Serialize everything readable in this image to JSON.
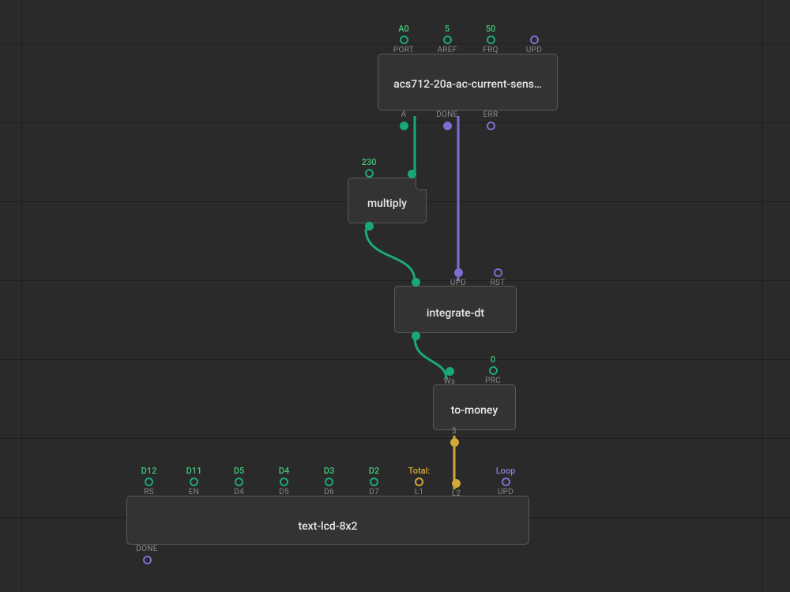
{
  "colors": {
    "teal": "#1ba877",
    "purple": "#7b6fd1",
    "yellow": "#d2a83a",
    "bg": "#2a2a2a",
    "node": "#333333"
  },
  "nodes": {
    "sensor": {
      "title": "acs712-20a-ac-current-sens…",
      "inputs": [
        {
          "name": "PORT",
          "value": "A0",
          "color": "teal"
        },
        {
          "name": "AREF",
          "value": "5",
          "color": "teal"
        },
        {
          "name": "FRQ",
          "value": "50",
          "color": "teal"
        },
        {
          "name": "UPD",
          "value": "",
          "color": "purple"
        }
      ],
      "outputs": [
        {
          "name": "A",
          "color": "teal",
          "filled": true
        },
        {
          "name": "DONE",
          "color": "purple",
          "filled": true
        },
        {
          "name": "ERR",
          "color": "purple",
          "filled": false
        }
      ]
    },
    "multiply": {
      "title": "multiply",
      "inputs": [
        {
          "name": "",
          "value": "230",
          "color": "teal"
        },
        {
          "name": "",
          "value": "",
          "color": "teal",
          "filled": true
        }
      ],
      "outputs": [
        {
          "name": "",
          "color": "teal",
          "filled": true
        }
      ]
    },
    "integrate": {
      "title": "integrate-dt",
      "inputs": [
        {
          "name": "",
          "value": "",
          "color": "teal",
          "filled": true
        },
        {
          "name": "UPD",
          "value": "",
          "color": "purple",
          "filled": true
        },
        {
          "name": "RST",
          "value": "",
          "color": "purple",
          "filled": false
        }
      ],
      "outputs": [
        {
          "name": "",
          "color": "teal",
          "filled": true
        }
      ]
    },
    "tomoney": {
      "title": "to-money",
      "inputs": [
        {
          "name": "Ws",
          "value": "",
          "color": "teal",
          "filled": true
        },
        {
          "name": "PRC",
          "value": "0",
          "color": "teal",
          "filled": false
        }
      ],
      "outputs": [
        {
          "name": "$",
          "color": "yellow",
          "filled": true
        }
      ]
    },
    "lcd": {
      "title": "text-lcd-8x2",
      "inputs": [
        {
          "name": "RS",
          "value": "D12",
          "color": "teal"
        },
        {
          "name": "EN",
          "value": "D11",
          "color": "teal"
        },
        {
          "name": "D4",
          "value": "D5",
          "color": "teal"
        },
        {
          "name": "D5",
          "value": "D4",
          "color": "teal"
        },
        {
          "name": "D6",
          "value": "D3",
          "color": "teal"
        },
        {
          "name": "D7",
          "value": "D2",
          "color": "teal"
        },
        {
          "name": "L1",
          "value": "Total:",
          "color": "yellow"
        },
        {
          "name": "L2",
          "value": "",
          "color": "yellow",
          "filled": true
        },
        {
          "name": "UPD",
          "value": "Loop",
          "color": "purple"
        }
      ],
      "outputs": [
        {
          "name": "DONE",
          "color": "purple",
          "filled": false
        }
      ]
    }
  },
  "wires": [
    {
      "from": "sensor.A",
      "to": "multiply.in2",
      "color": "teal"
    },
    {
      "from": "sensor.DONE",
      "to": "integrate.UPD",
      "color": "purple"
    },
    {
      "from": "multiply.out",
      "to": "integrate.in1",
      "color": "teal"
    },
    {
      "from": "integrate.out",
      "to": "tomoney.Ws",
      "color": "teal"
    },
    {
      "from": "tomoney.$",
      "to": "lcd.L2",
      "color": "yellow"
    }
  ]
}
